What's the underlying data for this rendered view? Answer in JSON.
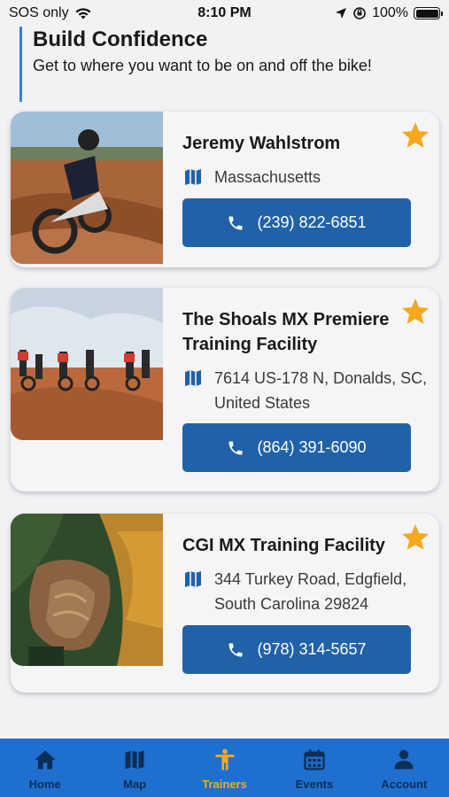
{
  "status_bar": {
    "carrier": "SOS only",
    "time": "8:10 PM",
    "battery": "100%"
  },
  "intro": {
    "title": "Build Confidence",
    "subtitle": "Get to where you want to be on and off the bike!"
  },
  "trainers": [
    {
      "name": "Jeremy Wahlstrom",
      "location": "Massachusetts",
      "phone": "(239) 822-6851",
      "favorite": true
    },
    {
      "name": "The Shoals MX Premiere\nTraining Facility",
      "location": "7614 US-178 N, Donalds, SC,\nUnited States",
      "phone": "(864) 391-6090",
      "favorite": true
    },
    {
      "name": "CGI MX Training Facility",
      "location": "344 Turkey Road, Edgfield,\nSouth Carolina 29824",
      "phone": "(978) 314-5657",
      "favorite": true
    }
  ],
  "tabs": [
    {
      "label": "Home",
      "icon": "home-icon"
    },
    {
      "label": "Map",
      "icon": "map-icon"
    },
    {
      "label": "Trainers",
      "icon": "trainer-icon",
      "active": true
    },
    {
      "label": "Events",
      "icon": "calendar-icon"
    },
    {
      "label": "Account",
      "icon": "account-icon"
    }
  ],
  "colors": {
    "accent_blue": "#2062a8",
    "tab_bar": "#1f6fcf",
    "active_tab": "#f3a81f",
    "star": "#f3a81f"
  }
}
